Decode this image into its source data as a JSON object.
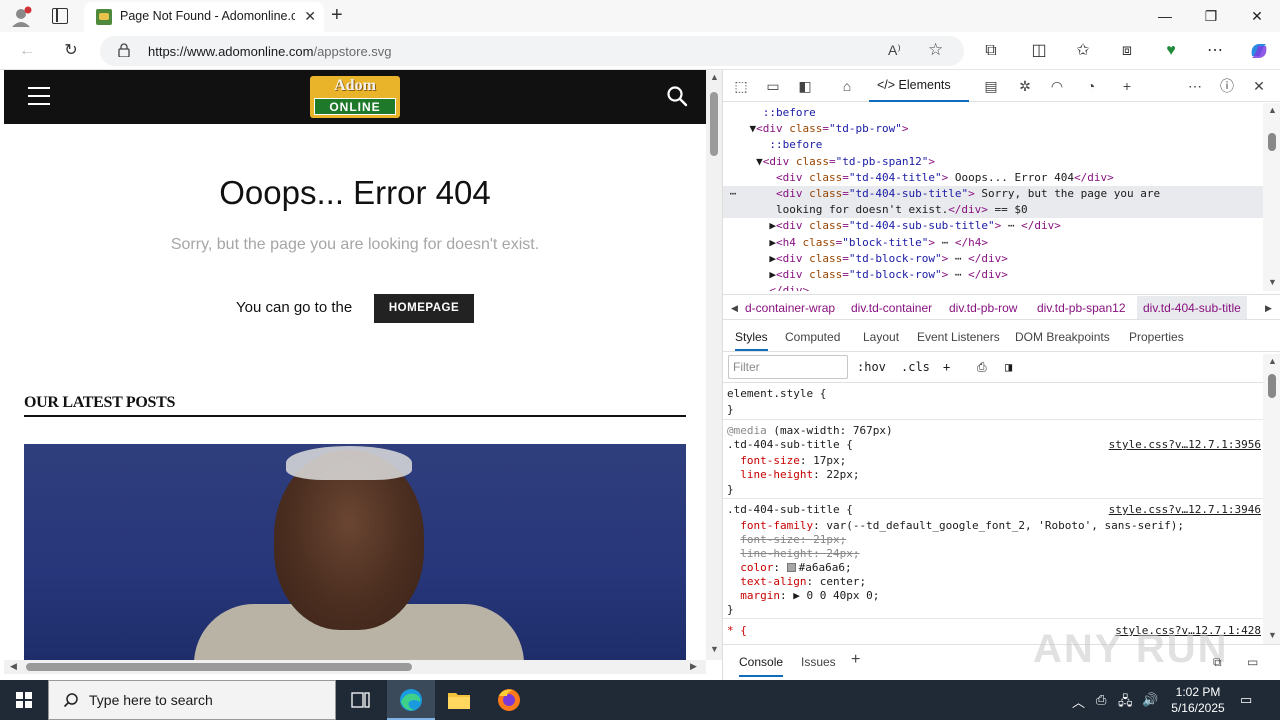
{
  "browser": {
    "tab_title": "Page Not Found - Adomonline.c",
    "url_host": "https://www.adomonline.com",
    "url_path": "/appstore.svg"
  },
  "page": {
    "logo_top": "Adom",
    "logo_bottom": "ONLINE",
    "error_title": "Ooops... Error 404",
    "error_subtitle": "Sorry, but the page you are looking for doesn't exist.",
    "goto_text": "You can go to the",
    "homepage_button": "HOMEPAGE",
    "latest_posts": "OUR LATEST POSTS"
  },
  "devtools": {
    "elements_tab": "Elements",
    "dom_lines": [
      {
        "indent": "   ",
        "html": "::before",
        "kind": "pseudo"
      },
      {
        "indent": " ▼",
        "tag": "div",
        "cls": "td-pb-row"
      },
      {
        "indent": "    ",
        "html": "::before",
        "kind": "pseudo"
      },
      {
        "indent": "  ▼",
        "tag": "div",
        "cls": "td-pb-span12"
      },
      {
        "indent": "     ",
        "tag": "div",
        "cls": "td-404-title",
        "text": " Ooops... Error 404",
        "close": "div"
      },
      {
        "indent": "     ",
        "tag": "div",
        "cls": "td-404-sub-title",
        "text": " Sorry, but the page you are",
        "selected": true
      },
      {
        "indent": "     ",
        "html": "looking for doesn't exist.</div> == $0",
        "kind": "selcont",
        "selected": true
      },
      {
        "indent": "    ▶",
        "tag": "div",
        "cls": "td-404-sub-sub-title",
        "text": " ⋯ ",
        "close": "div"
      },
      {
        "indent": "    ▶",
        "tag": "h4",
        "cls": "block-title",
        "text": " ⋯ ",
        "close": "h4"
      },
      {
        "indent": "    ▶",
        "tag": "div",
        "cls": "td-block-row",
        "text": " ⋯ ",
        "close": "div"
      },
      {
        "indent": "    ▶",
        "tag": "div",
        "cls": "td-block-row",
        "text": " ⋯ ",
        "close": "div"
      },
      {
        "indent": "    ",
        "html": "</div>",
        "kind": "close"
      }
    ],
    "breadcrumbs": [
      "d-container-wrap",
      "div.td-container",
      "div.td-pb-row",
      "div.td-pb-span12",
      "div.td-404-sub-title"
    ],
    "subtabs": [
      "Styles",
      "Computed",
      "Layout",
      "Event Listeners",
      "DOM Breakpoints",
      "Properties"
    ],
    "filter_placeholder": "Filter",
    "filter_tools": [
      ":hov",
      ".cls"
    ],
    "styles": {
      "element_style": "element.style {",
      "close": "}",
      "media": "@media",
      "media_query": " (max-width: 767px)",
      "rule1_selector": ".td-404-sub-title {",
      "rule1_src": "style.css?v…12.7.1:3956",
      "rule1_props": [
        [
          "font-size",
          "17px;"
        ],
        [
          "line-height",
          "22px;"
        ]
      ],
      "rule2_selector": ".td-404-sub-title {",
      "rule2_src": "style.css?v…12.7.1:3946",
      "rule2_props": [
        [
          "font-family",
          "var(--td_default_google_font_2, 'Roboto', sans-serif);",
          false
        ],
        [
          "font-size",
          "21px;",
          true
        ],
        [
          "line-height",
          "24px;",
          true
        ],
        [
          "color",
          "#a6a6a6;",
          false
        ],
        [
          "text-align",
          "center;",
          false
        ],
        [
          "margin",
          "▶ 0 0 40px 0;",
          false
        ]
      ],
      "rule3_selector": "* {",
      "rule3_src": "style.css?v…12.7.1:428"
    },
    "drawer_tabs": [
      "Console",
      "Issues"
    ],
    "watermark": "ANY RUN"
  },
  "taskbar": {
    "search_placeholder": "Type here to search",
    "time": "1:02 PM",
    "date": "5/16/2025"
  }
}
